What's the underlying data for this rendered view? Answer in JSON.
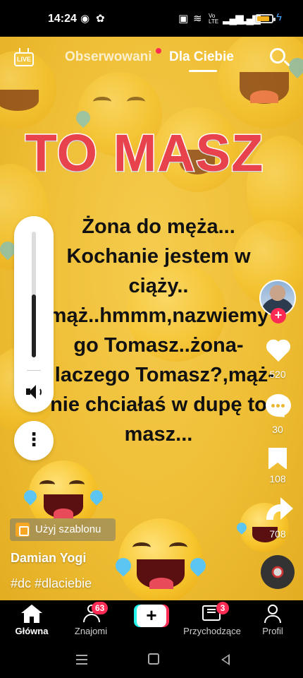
{
  "status_bar": {
    "time": "14:24",
    "network_label": "Vo LTE",
    "battery_color": "#f2b01e",
    "icons": [
      "chrome-icon",
      "notification-icon",
      "nfc-icon",
      "wifi-icon",
      "signal-icon",
      "battery-icon",
      "charging-icon"
    ]
  },
  "top_nav": {
    "live_label": "LIVE",
    "tabs": [
      {
        "label": "Obserwowani",
        "active": false,
        "has_dot": true
      },
      {
        "label": "Dla Ciebie",
        "active": true,
        "has_dot": false
      }
    ]
  },
  "video": {
    "headline": "TO MASZ",
    "joke_text": "Żona do męża... Kochanie jestem w ciąży.. mąż..hmmm,nazwiemy go Tomasz..żona-dlaczego Tomasz?,mąż-nie chciałaś w dupę to masz...",
    "background_color": "#eebd33",
    "headline_color": "#e8424d"
  },
  "volume": {
    "level_fraction": 0.5
  },
  "actions": {
    "likes": "520",
    "comments": "30",
    "saves": "108",
    "shares": "708"
  },
  "caption": {
    "template_button": "Użyj szablonu",
    "author": "Damian Yogi",
    "hashtags": "#dc #dlaciebie"
  },
  "bottom_nav": {
    "items": [
      {
        "label": "Główna",
        "active": true
      },
      {
        "label": "Znajomi",
        "badge": "63"
      },
      {
        "label": ""
      },
      {
        "label": "Przychodzące",
        "badge": "3"
      },
      {
        "label": "Profil"
      }
    ],
    "accent_color": "#fe2c55",
    "create_colors": [
      "#25f4ee",
      "#fe2c55"
    ]
  }
}
